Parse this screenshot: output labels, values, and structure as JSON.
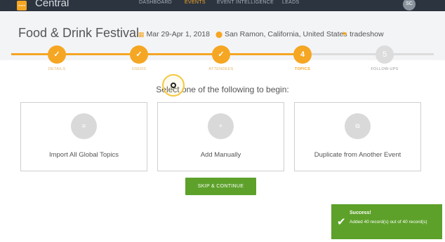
{
  "app": {
    "logo_text": "event",
    "title": "Central",
    "user_initials": "SC"
  },
  "nav": {
    "items": [
      {
        "label": "DASHBOARD"
      },
      {
        "label": "EVENTS",
        "active": true
      },
      {
        "label": "EVENT INTELLIGENCE"
      },
      {
        "label": "LEADS"
      }
    ]
  },
  "event": {
    "title": "Food & Drink Festival",
    "dates": "Mar 29-Apr 1, 2018",
    "location": "San Ramon, California, United States",
    "type": "tradeshow"
  },
  "wizard": {
    "steps": [
      {
        "label": "DETAILS",
        "marker": "✓",
        "state": "done"
      },
      {
        "label": "USERS",
        "marker": "✓",
        "state": "done"
      },
      {
        "label": "ATTENDEES",
        "marker": "✓",
        "state": "done"
      },
      {
        "label": "TOPICS",
        "marker": "4",
        "state": "current"
      },
      {
        "label": "FOLLOW-UPS",
        "marker": "5",
        "state": "pending"
      }
    ]
  },
  "main": {
    "instruction": "Select one of the following to begin:",
    "options": [
      {
        "label": "Import All Global Topics",
        "icon": "list-icon",
        "glyph": "≡"
      },
      {
        "label": "Add Manually",
        "icon": "plus-icon",
        "glyph": "+"
      },
      {
        "label": "Duplicate from Another Event",
        "icon": "copy-icon",
        "glyph": "⧉"
      }
    ],
    "skip_label": "SKIP & CONTINUE"
  },
  "toast": {
    "title": "Success!",
    "message": "Added 40 record(s) out of 40 record(s)",
    "icon": "check-icon"
  },
  "colors": {
    "accent": "#f5a623",
    "success": "#5da12a",
    "topbar": "#2c3440",
    "pending": "#dcdcdc"
  }
}
